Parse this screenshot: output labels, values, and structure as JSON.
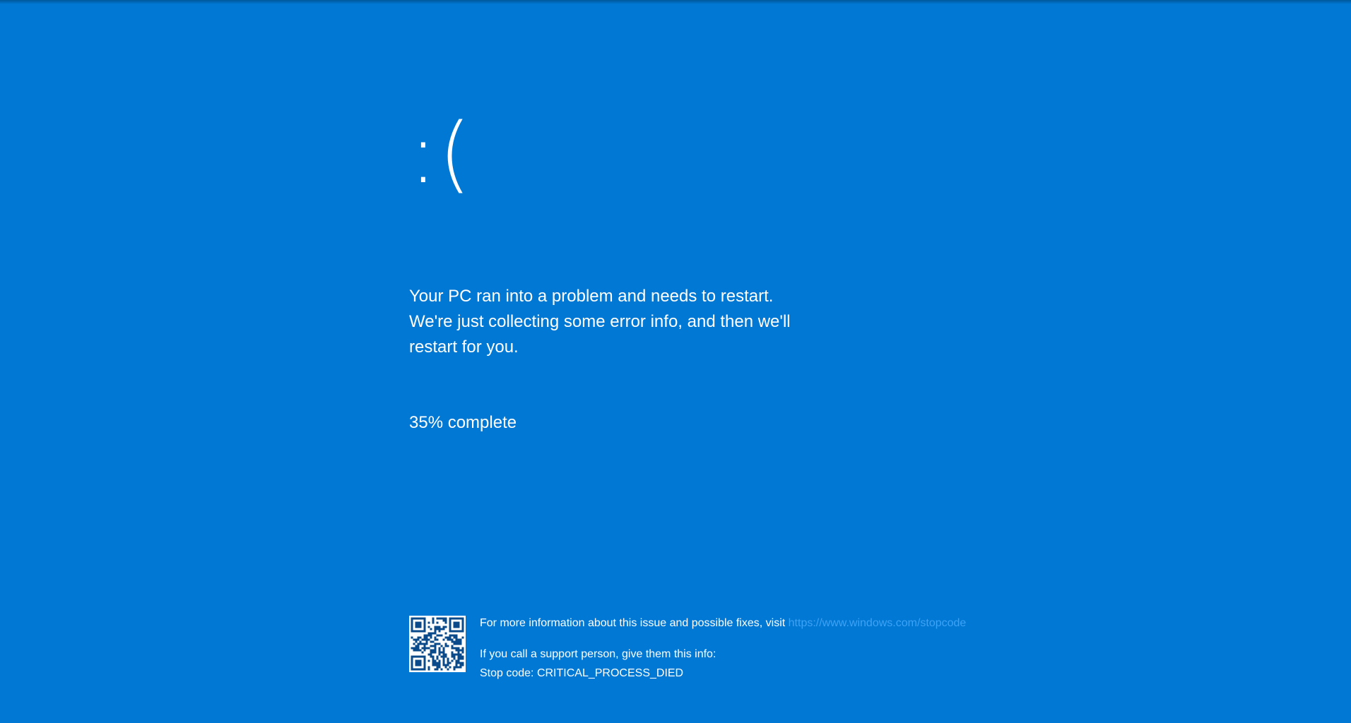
{
  "colors": {
    "background": "#0078d4",
    "text": "#ffffff",
    "link": "#3ea2f5"
  },
  "emoticon": ":(",
  "message": "Your PC ran into a problem and needs to restart. We're just collecting some error info, and then we'll restart for you.",
  "progress": {
    "percent": 35,
    "label": "35% complete"
  },
  "footer": {
    "qr_icon": "qr-code-icon",
    "more_info_prefix": "For more information about this issue and possible fixes, visit",
    "link_text": "https://www.windows.com/stopcode",
    "support_text": "If you call a support person, give them this info:",
    "stop_code": "Stop code: CRITICAL_PROCESS_DIED"
  }
}
